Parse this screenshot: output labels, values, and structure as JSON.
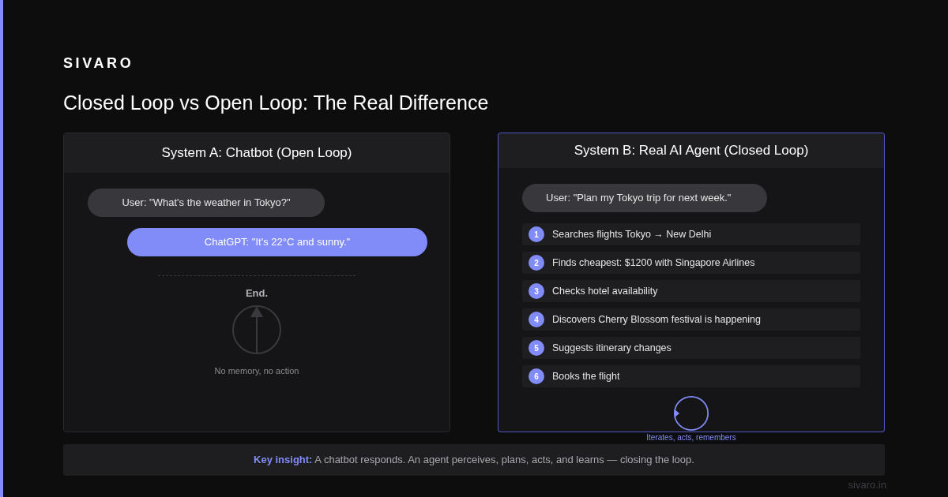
{
  "brand": "SIVARO",
  "title": "Closed Loop vs Open Loop: The Real Difference",
  "panel_a": {
    "title": "System A: Chatbot (Open Loop)",
    "messages": [
      {
        "kind": "user",
        "text": "User: \"What's the weather in Tokyo?\""
      },
      {
        "kind": "bot",
        "text": "ChatGPT: \"It's 22°C and sunny.\""
      }
    ],
    "end_label": "End.",
    "caption": "No memory, no action"
  },
  "panel_b": {
    "title": "System B: Real AI Agent (Closed Loop)",
    "message": "User: \"Plan my Tokyo trip for next week.\"",
    "steps": [
      {
        "number": "1",
        "text": "Searches flights Tokyo → New Delhi"
      },
      {
        "number": "2",
        "text": "Finds cheapest: $1200 with Singapore Airlines"
      },
      {
        "number": "3",
        "text": "Checks hotel availability"
      },
      {
        "number": "4",
        "text": "Discovers Cherry Blossom festival is happening"
      },
      {
        "number": "5",
        "text": "Suggests itinerary changes"
      },
      {
        "number": "6",
        "text": "Books the flight"
      }
    ],
    "caption": "Iterates, acts, remembers"
  },
  "insight": "**Key insight:** A chatbot responds. An agent perceives, plans, acts, and learns — closing the loop.",
  "footer": "sivaro.in"
}
